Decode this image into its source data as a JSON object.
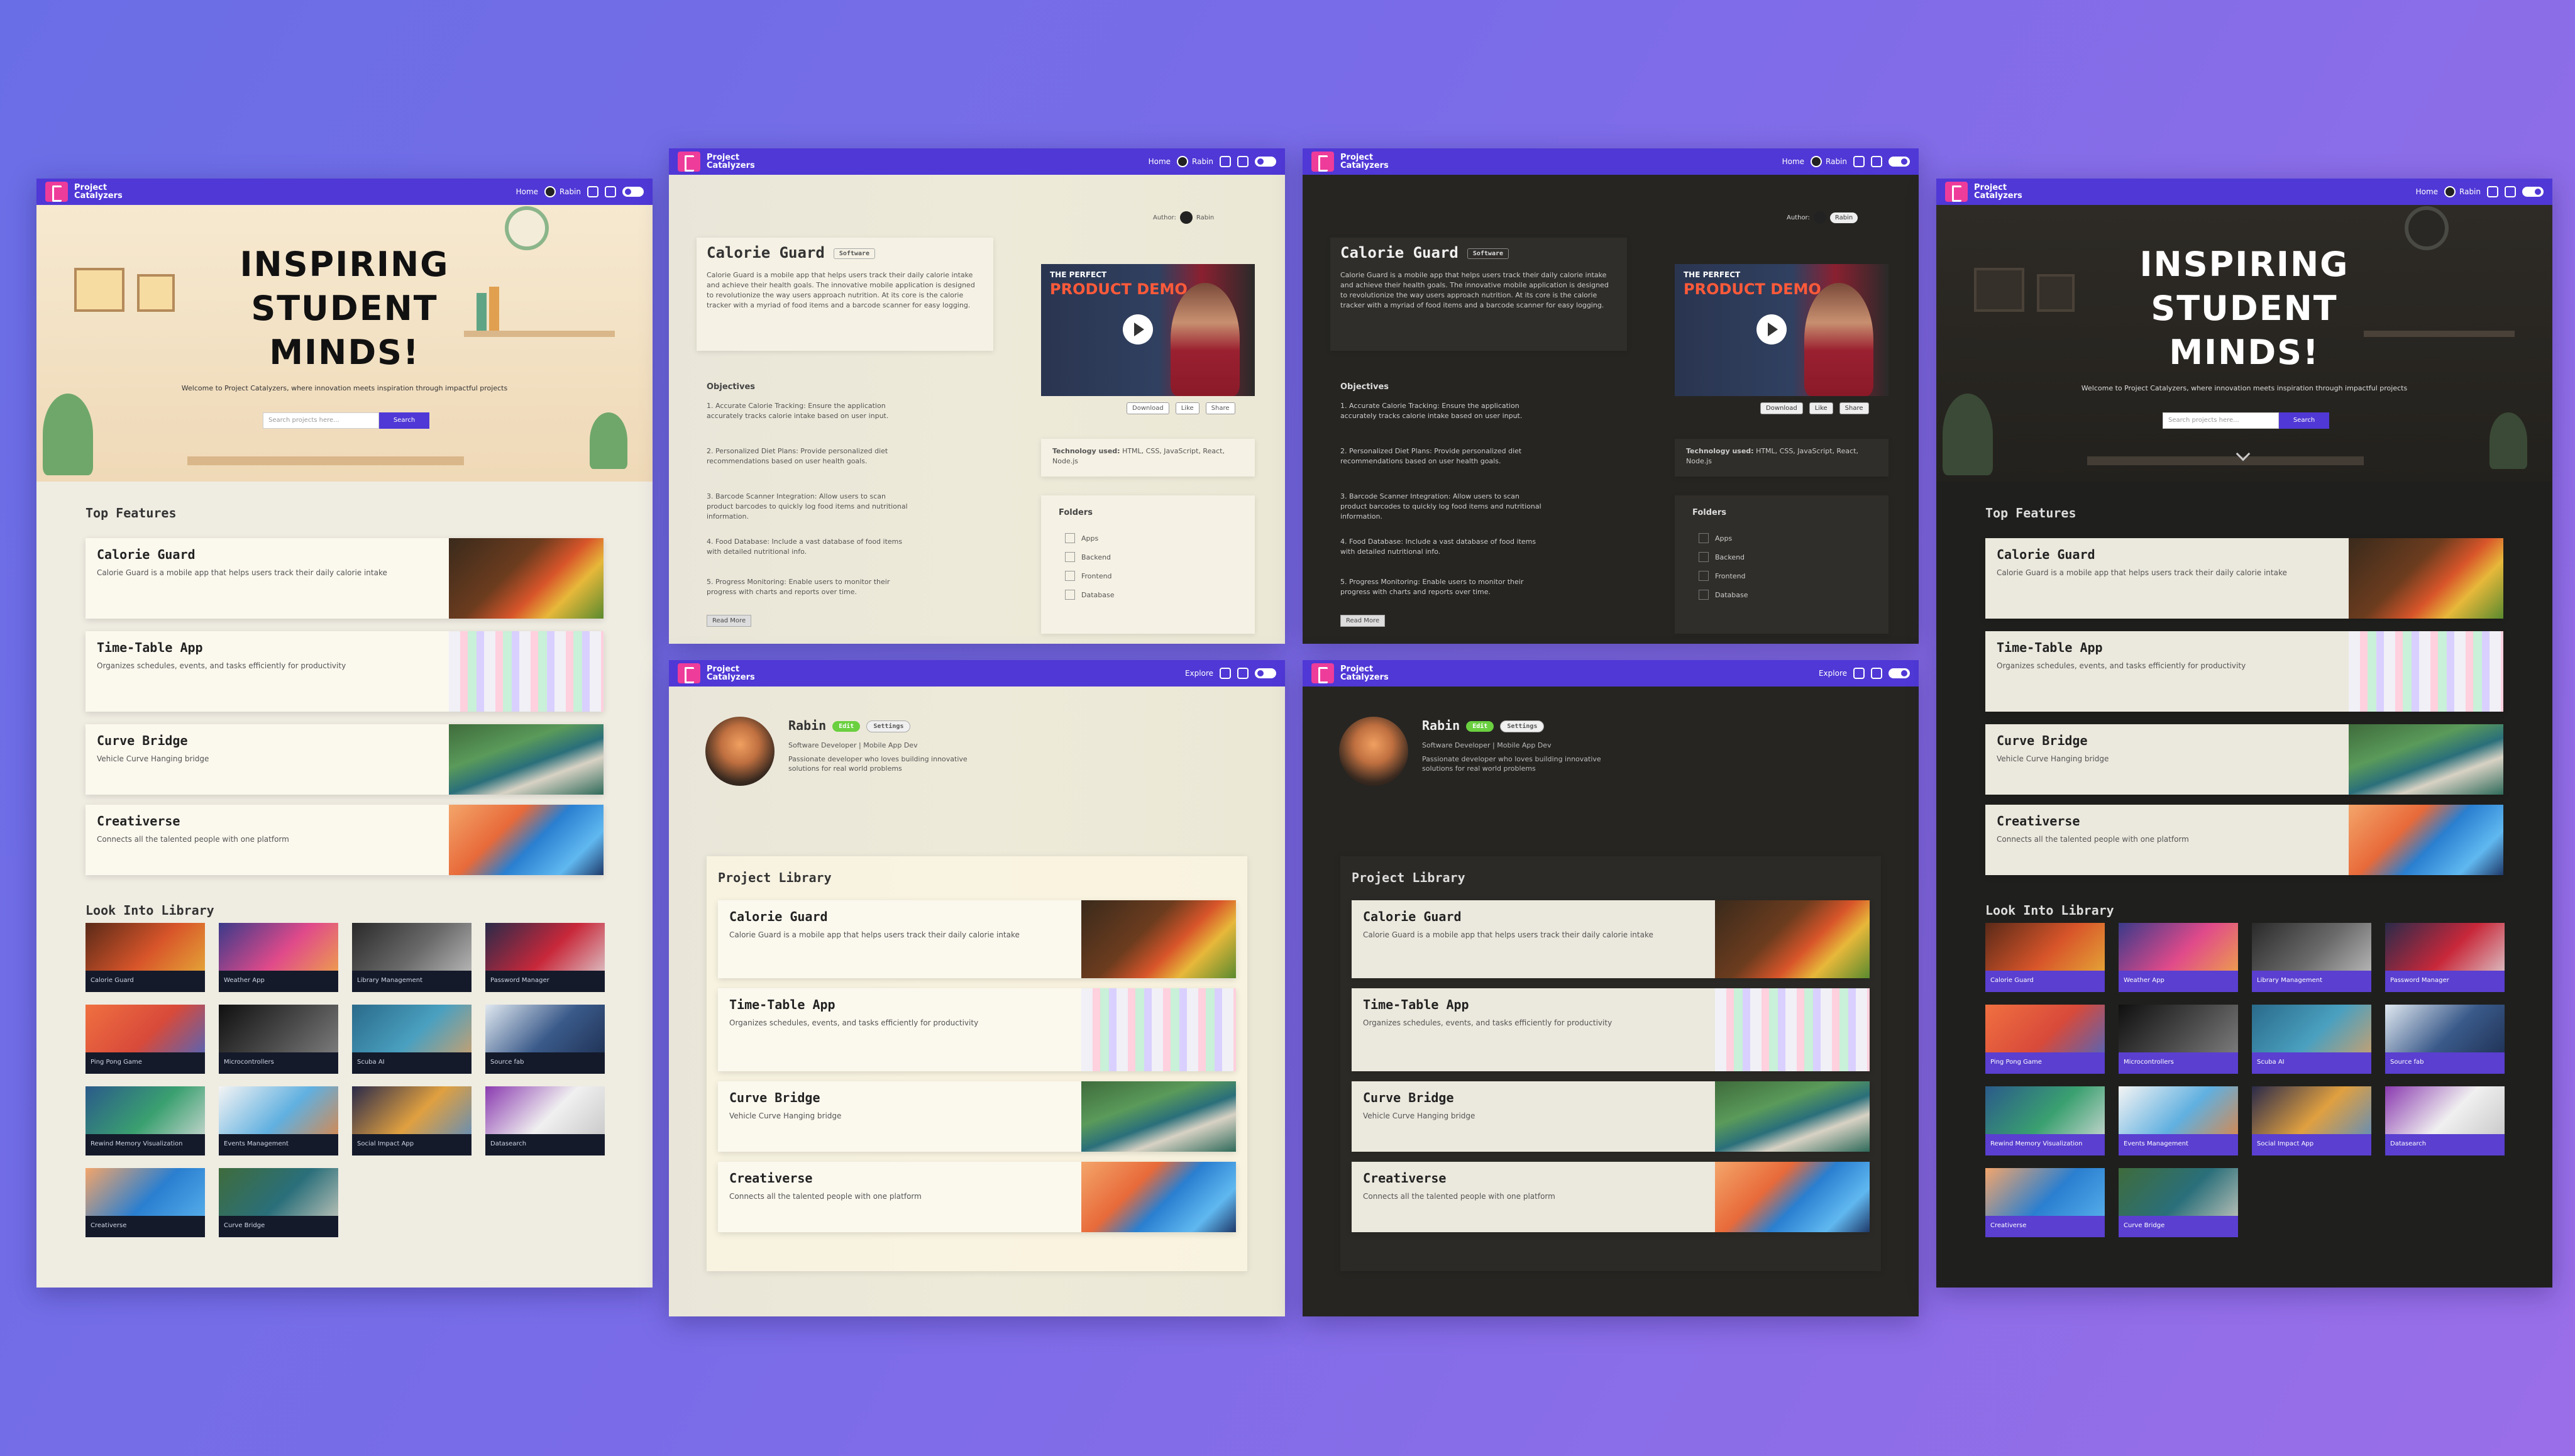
{
  "brand": {
    "name": "Project Catalyzers"
  },
  "nav": {
    "home": "Home",
    "user": "Rabin",
    "explore": "Explore"
  },
  "hero": {
    "title_lines": [
      "INSPIRING",
      "STUDENT",
      "MINDS!"
    ],
    "subtitle": "Welcome to Project Catalyzers, where innovation meets inspiration through impactful projects",
    "search_placeholder": "Search projects here...",
    "search_button": "Search"
  },
  "features": {
    "title": "Top Features",
    "items": [
      {
        "title": "Calorie Guard",
        "desc": "Calorie Guard is a mobile app that helps users track their daily calorie intake"
      },
      {
        "title": "Time-Table App",
        "desc": "Organizes schedules, events, and tasks efficiently for productivity"
      },
      {
        "title": "Curve Bridge",
        "desc": "Vehicle Curve Hanging bridge"
      },
      {
        "title": "Creativerse",
        "desc": "Connects all the talented people with one platform"
      }
    ]
  },
  "library": {
    "title": "Look Into Library",
    "tiles": [
      "Calorie Guard",
      "Weather App",
      "Library Management",
      "Password Manager",
      "Ping Pong Game",
      "Microcontrollers",
      "Scuba AI",
      "Source fab",
      "Rewind Memory Visualization",
      "Events Management",
      "Social Impact App",
      "Datasearch",
      "Creativerse",
      "Curve Bridge"
    ]
  },
  "detail": {
    "title": "Calorie Guard",
    "tag": "Software",
    "author_label": "Author:",
    "author_name": "Rabin",
    "intro": "Calorie Guard is a mobile app that helps users track their daily calorie intake and achieve their health goals. The innovative mobile application is designed to revolutionize the way users approach nutrition. At its core is the calorie tracker with a myriad of food items and a barcode scanner for easy logging.",
    "objectives_title": "Objectives",
    "objectives": [
      "1. Accurate Calorie Tracking: Ensure the application accurately tracks calorie intake based on user input.",
      "2. Personalized Diet Plans: Provide personalized diet recommendations based on user health goals.",
      "3. Barcode Scanner Integration: Allow users to scan product barcodes to quickly log food items and nutritional information.",
      "4. Food Database: Include a vast database of food items with detailed nutritional info.",
      "5. Progress Monitoring: Enable users to monitor their progress with charts and reports over time."
    ],
    "read_more": "Read More",
    "video": {
      "line1": "THE PERFECT",
      "line2": "PRODUCT DEMO"
    },
    "video_buttons": [
      "Download",
      "Like",
      "Share"
    ],
    "tech_label": "Technology used:",
    "tech_value": "HTML, CSS, JavaScript, React, Node.js",
    "folders_title": "Folders",
    "folders": [
      "Apps",
      "Backend",
      "Frontend",
      "Database"
    ]
  },
  "profile": {
    "name": "Rabin",
    "badge_primary": "Edit",
    "badge_secondary": "Settings",
    "meta_line": "Software Developer | Mobile App Dev",
    "bio": "Passionate developer who loves building innovative solutions for real world problems",
    "library_title": "Project Library"
  }
}
